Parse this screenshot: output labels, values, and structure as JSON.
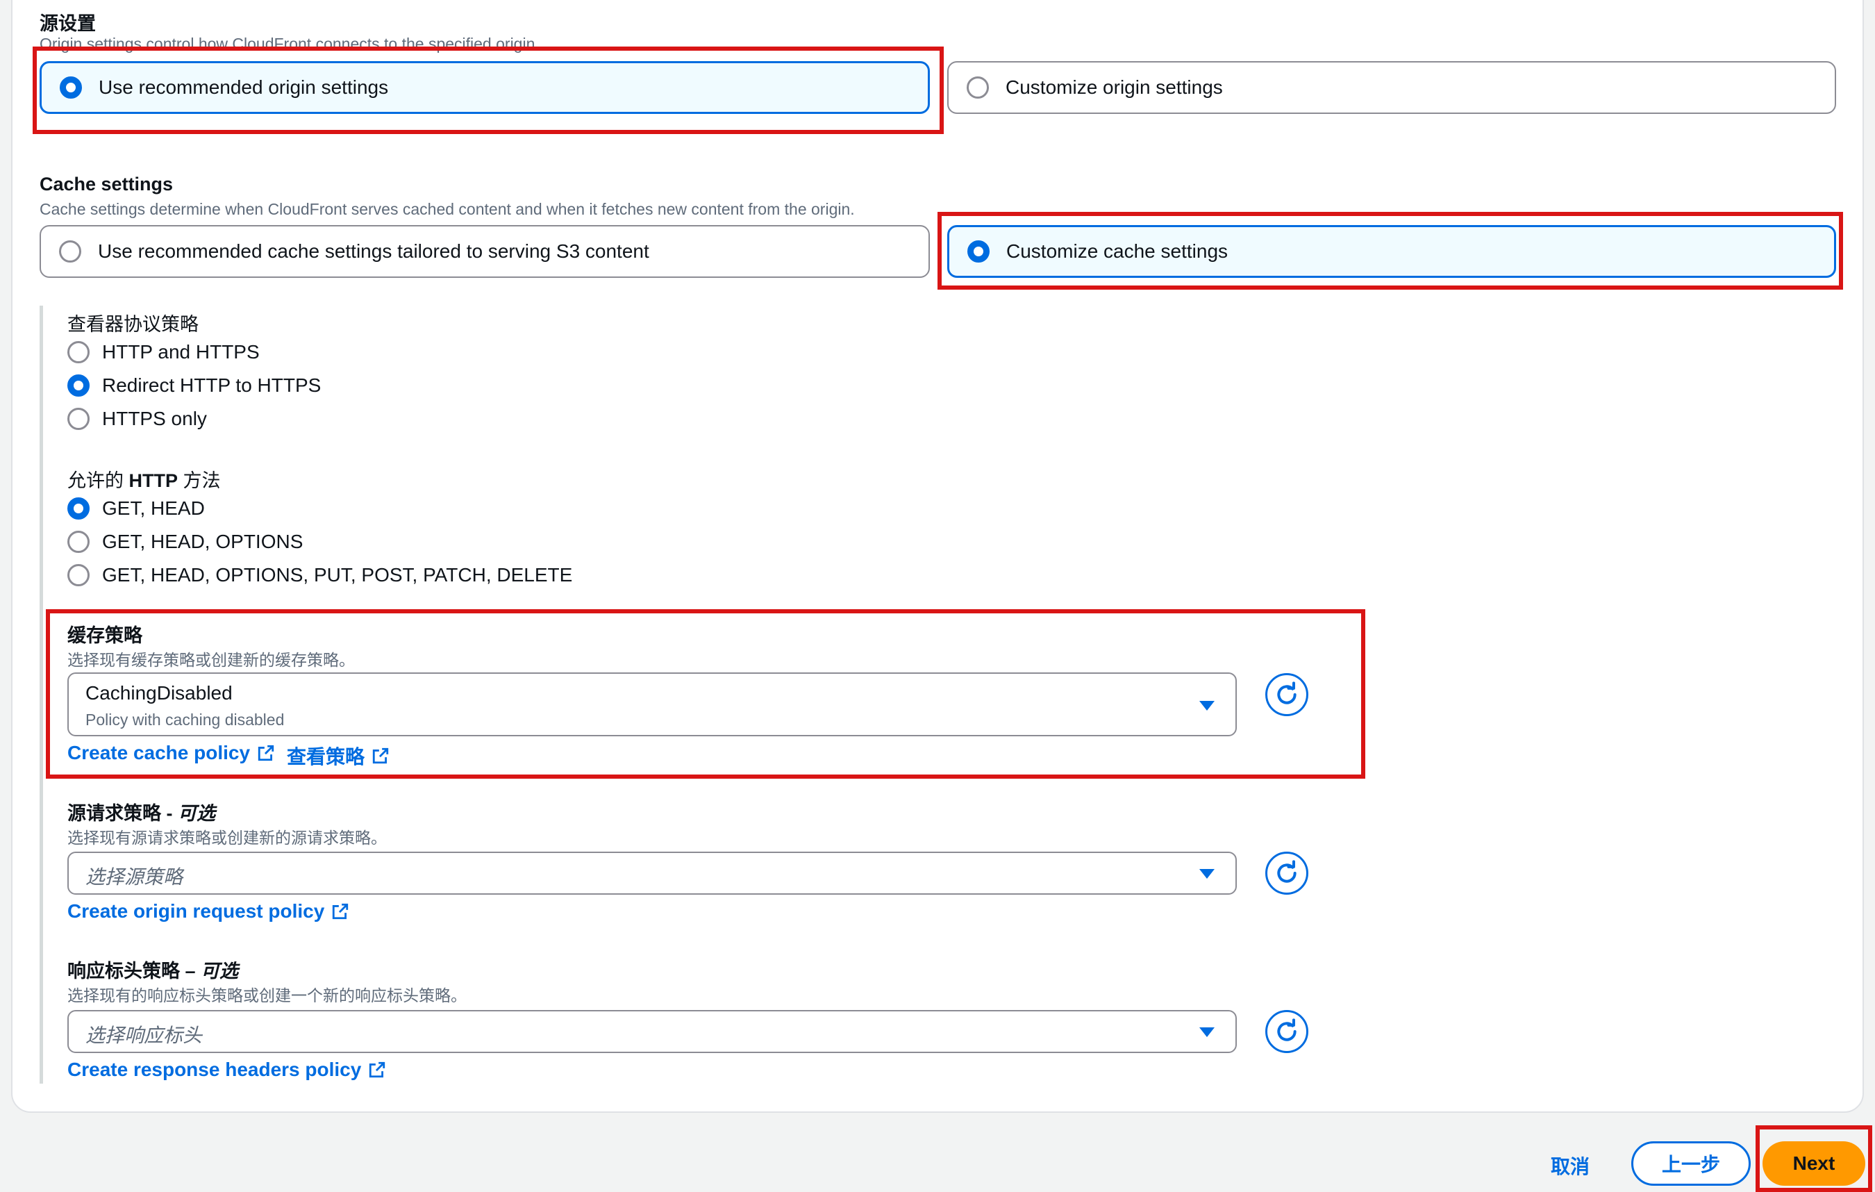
{
  "origin_settings": {
    "title": "源设置",
    "description": "Origin settings control how CloudFront connects to the specified origin.",
    "options": [
      {
        "label": "Use recommended origin settings",
        "selected": true
      },
      {
        "label": "Customize origin settings",
        "selected": false
      }
    ]
  },
  "cache_settings": {
    "title": "Cache settings",
    "description": "Cache settings determine when CloudFront serves cached content and when it fetches new content from the origin.",
    "options": [
      {
        "label": "Use recommended cache settings tailored to serving S3 content",
        "selected": false
      },
      {
        "label": "Customize cache settings",
        "selected": true
      }
    ]
  },
  "viewer_protocol": {
    "title": "查看器协议策略",
    "options": [
      {
        "label": "HTTP and HTTPS",
        "selected": false
      },
      {
        "label": "Redirect HTTP to HTTPS",
        "selected": true
      },
      {
        "label": "HTTPS only",
        "selected": false
      }
    ]
  },
  "allowed_methods": {
    "title_prefix": "允许的",
    "title_bold": "HTTP",
    "title_suffix": "方法",
    "options": [
      {
        "label": "GET, HEAD",
        "selected": true
      },
      {
        "label": "GET, HEAD, OPTIONS",
        "selected": false
      },
      {
        "label": "GET, HEAD, OPTIONS, PUT, POST, PATCH, DELETE",
        "selected": false
      }
    ]
  },
  "cache_policy": {
    "title": "缓存策略",
    "description": "选择现有缓存策略或创建新的缓存策略。",
    "selected_value": "CachingDisabled",
    "selected_subtext": "Policy with caching disabled",
    "create_link": "Create cache policy",
    "view_link": "查看策略"
  },
  "origin_request_policy": {
    "title": "源请求策略 -",
    "optional": "可选",
    "description": "选择现有源请求策略或创建新的源请求策略。",
    "placeholder": "选择源策略",
    "create_link": "Create origin request policy"
  },
  "response_headers_policy": {
    "title": "响应标头策略 –",
    "optional": "可选",
    "description": "选择现有的响应标头策略或创建一个新的响应标头策略。",
    "placeholder": "选择响应标头",
    "create_link": "Create response headers policy"
  },
  "footer": {
    "cancel": "取消",
    "previous": "上一步",
    "next": "Next"
  },
  "colors": {
    "accent": "#006ce0",
    "primary_button": "#ff9900",
    "highlight": "#d91515"
  }
}
